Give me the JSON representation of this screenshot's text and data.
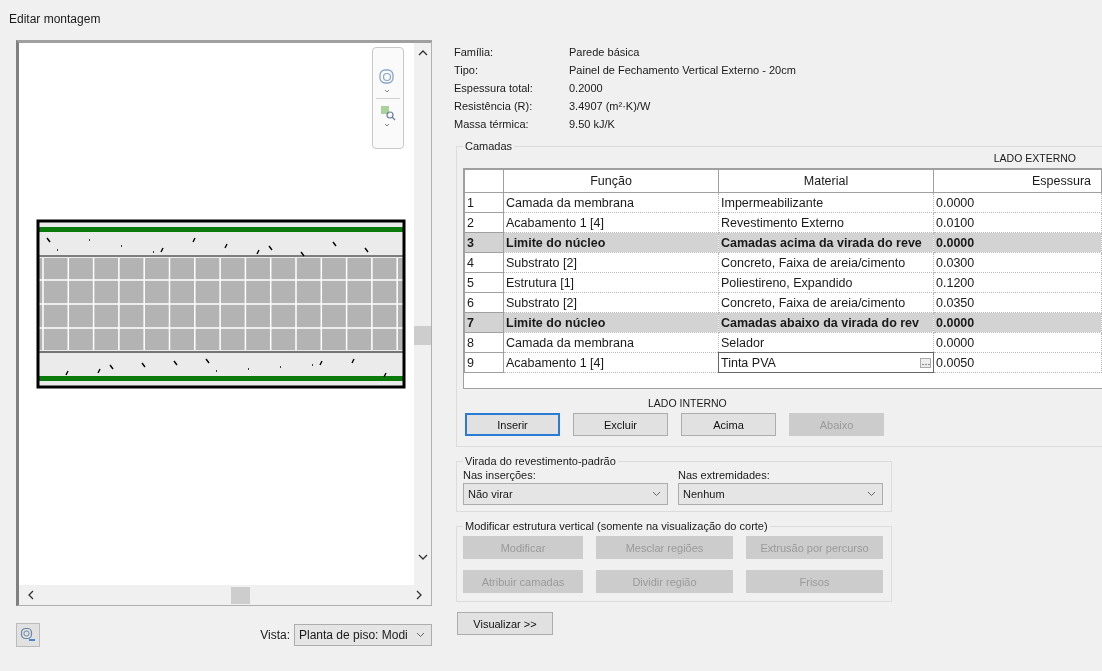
{
  "window": {
    "title": "Editar montagem"
  },
  "properties": [
    {
      "label": "Família:",
      "value": "Parede básica"
    },
    {
      "label": "Tipo:",
      "value": "Painel de Fechamento Vertical Externo - 20cm"
    },
    {
      "label": "Espessura total:",
      "value": "0.2000"
    },
    {
      "label": "Resistência (R):",
      "value": "3.4907 (m²·K)/W"
    },
    {
      "label": "Massa térmica:",
      "value": "9.50 kJ/K"
    }
  ],
  "layers": {
    "title": "Camadas",
    "top_side": "LADO EXTERNO",
    "bottom_side": "LADO INTERNO",
    "columns": [
      "Função",
      "Material",
      "Espessura"
    ],
    "rows": [
      {
        "number": "1",
        "function": "Camada da membrana",
        "material": "Impermeabilizante",
        "thickness": "0.0000",
        "kind": "layer",
        "editing": false
      },
      {
        "number": "2",
        "function": "Acabamento 1 [4]",
        "material": "Revestimento Externo",
        "thickness": "0.0100",
        "kind": "layer",
        "editing": false
      },
      {
        "number": "3",
        "function": "Limite do núcleo",
        "material": "Camadas acima da virada do reve",
        "thickness": "0.0000",
        "kind": "core",
        "editing": false
      },
      {
        "number": "4",
        "function": "Substrato [2]",
        "material": "Concreto, Faixa de areia/cimento",
        "thickness": "0.0300",
        "kind": "layer",
        "editing": false
      },
      {
        "number": "5",
        "function": "Estrutura [1]",
        "material": "Poliestireno, Expandido",
        "thickness": "0.1200",
        "kind": "layer",
        "editing": false
      },
      {
        "number": "6",
        "function": "Substrato [2]",
        "material": "Concreto, Faixa de areia/cimento",
        "thickness": "0.0350",
        "kind": "layer",
        "editing": false
      },
      {
        "number": "7",
        "function": "Limite do núcleo",
        "material": "Camadas abaixo da virada do rev",
        "thickness": "0.0000",
        "kind": "core",
        "editing": false
      },
      {
        "number": "8",
        "function": "Camada da membrana",
        "material": "Selador",
        "thickness": "0.0000",
        "kind": "layer",
        "editing": false
      },
      {
        "number": "9",
        "function": "Acabamento 1 [4]",
        "material": "Tinta PVA",
        "thickness": "0.0050",
        "kind": "layer",
        "editing": true
      }
    ],
    "buttons": [
      {
        "label": "Inserir",
        "focused": true,
        "disabled": false
      },
      {
        "label": "Excluir",
        "focused": false,
        "disabled": false
      },
      {
        "label": "Acima",
        "focused": false,
        "disabled": false
      },
      {
        "label": "Abaixo",
        "focused": false,
        "disabled": true
      }
    ]
  },
  "wrapping": {
    "title": "Virada do revestimento-padrão",
    "dropdowns": [
      {
        "label": "Nas inserções:",
        "value": "Não virar"
      },
      {
        "label": "Nas extremidades:",
        "value": "Nenhum"
      }
    ]
  },
  "vertical_structure": {
    "title": "Modificar estrutura vertical (somente na visualização do corte)",
    "buttons": [
      {
        "label": "Modificar",
        "disabled": true
      },
      {
        "label": "Mesclar regiões",
        "disabled": true
      },
      {
        "label": "Extrusão por percurso",
        "disabled": true
      },
      {
        "label": "Atribuir camadas",
        "disabled": true
      },
      {
        "label": "Dividir região",
        "disabled": true
      },
      {
        "label": "Frisos",
        "disabled": true
      }
    ]
  },
  "preview_button": "Visualizar >>",
  "view": {
    "label": "Vista:",
    "value": "Planta de piso: Modi"
  }
}
